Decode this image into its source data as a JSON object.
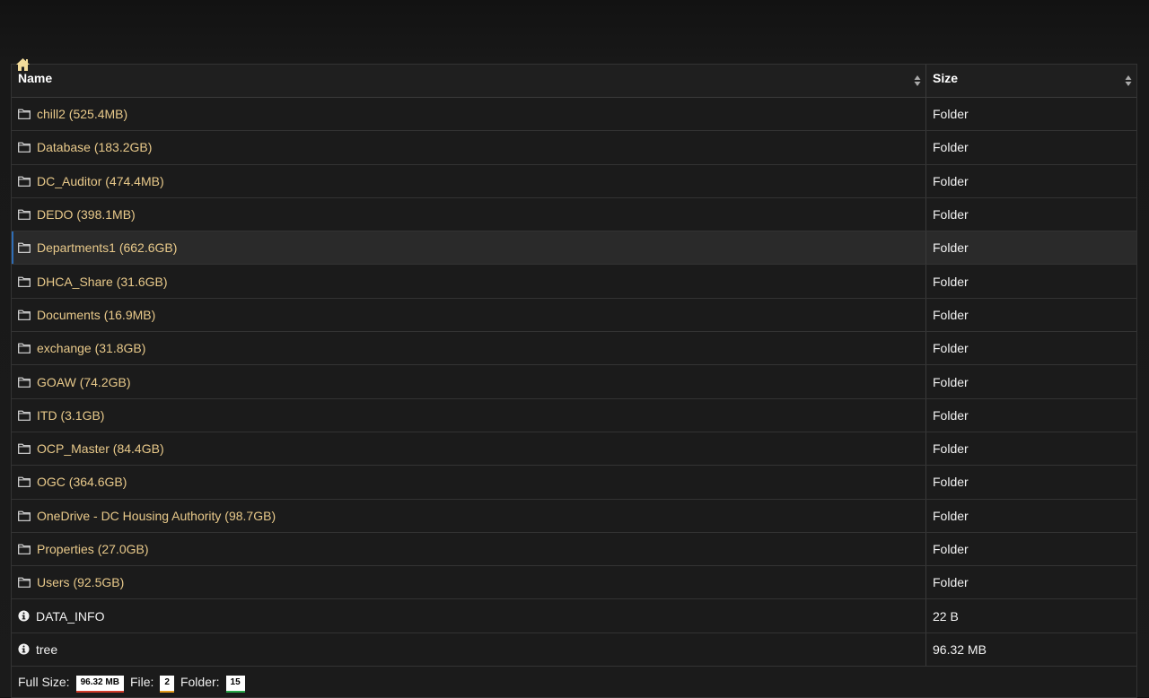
{
  "header": {
    "name_label": "Name",
    "size_label": "Size"
  },
  "folders": [
    {
      "label": "chill2 (525.4MB)",
      "size": "Folder"
    },
    {
      "label": "Database (183.2GB)",
      "size": "Folder"
    },
    {
      "label": "DC_Auditor (474.4MB)",
      "size": "Folder"
    },
    {
      "label": "DEDO (398.1MB)",
      "size": "Folder"
    },
    {
      "label": "Departments1 (662.6GB)",
      "size": "Folder"
    },
    {
      "label": "DHCA_Share (31.6GB)",
      "size": "Folder"
    },
    {
      "label": "Documents (16.9MB)",
      "size": "Folder"
    },
    {
      "label": "exchange (31.8GB)",
      "size": "Folder"
    },
    {
      "label": "GOAW (74.2GB)",
      "size": "Folder"
    },
    {
      "label": "ITD (3.1GB)",
      "size": "Folder"
    },
    {
      "label": "OCP_Master (84.4GB)",
      "size": "Folder"
    },
    {
      "label": "OGC (364.6GB)",
      "size": "Folder"
    },
    {
      "label": "OneDrive - DC Housing Authority (98.7GB)",
      "size": "Folder"
    },
    {
      "label": "Properties (27.0GB)",
      "size": "Folder"
    },
    {
      "label": "Users (92.5GB)",
      "size": "Folder"
    }
  ],
  "files": [
    {
      "label": "DATA_INFO",
      "size": "22 B"
    },
    {
      "label": "tree",
      "size": "96.32 MB"
    }
  ],
  "footer": {
    "full_size_label": "Full Size:",
    "full_size_value": "96.32 MB",
    "file_label": "File:",
    "file_count": "2",
    "folder_label": "Folder:",
    "folder_count": "15"
  },
  "icons": {
    "home": "home-icon",
    "folder": "folder-icon",
    "info": "info-icon",
    "sort": "sort-icon"
  },
  "colors": {
    "folder_text": "#e8c98a",
    "highlight_row": "#2a2a2a",
    "badge_full_size": "#d23b2a",
    "badge_file": "#e39b1e",
    "badge_folder": "#2aa84a"
  }
}
